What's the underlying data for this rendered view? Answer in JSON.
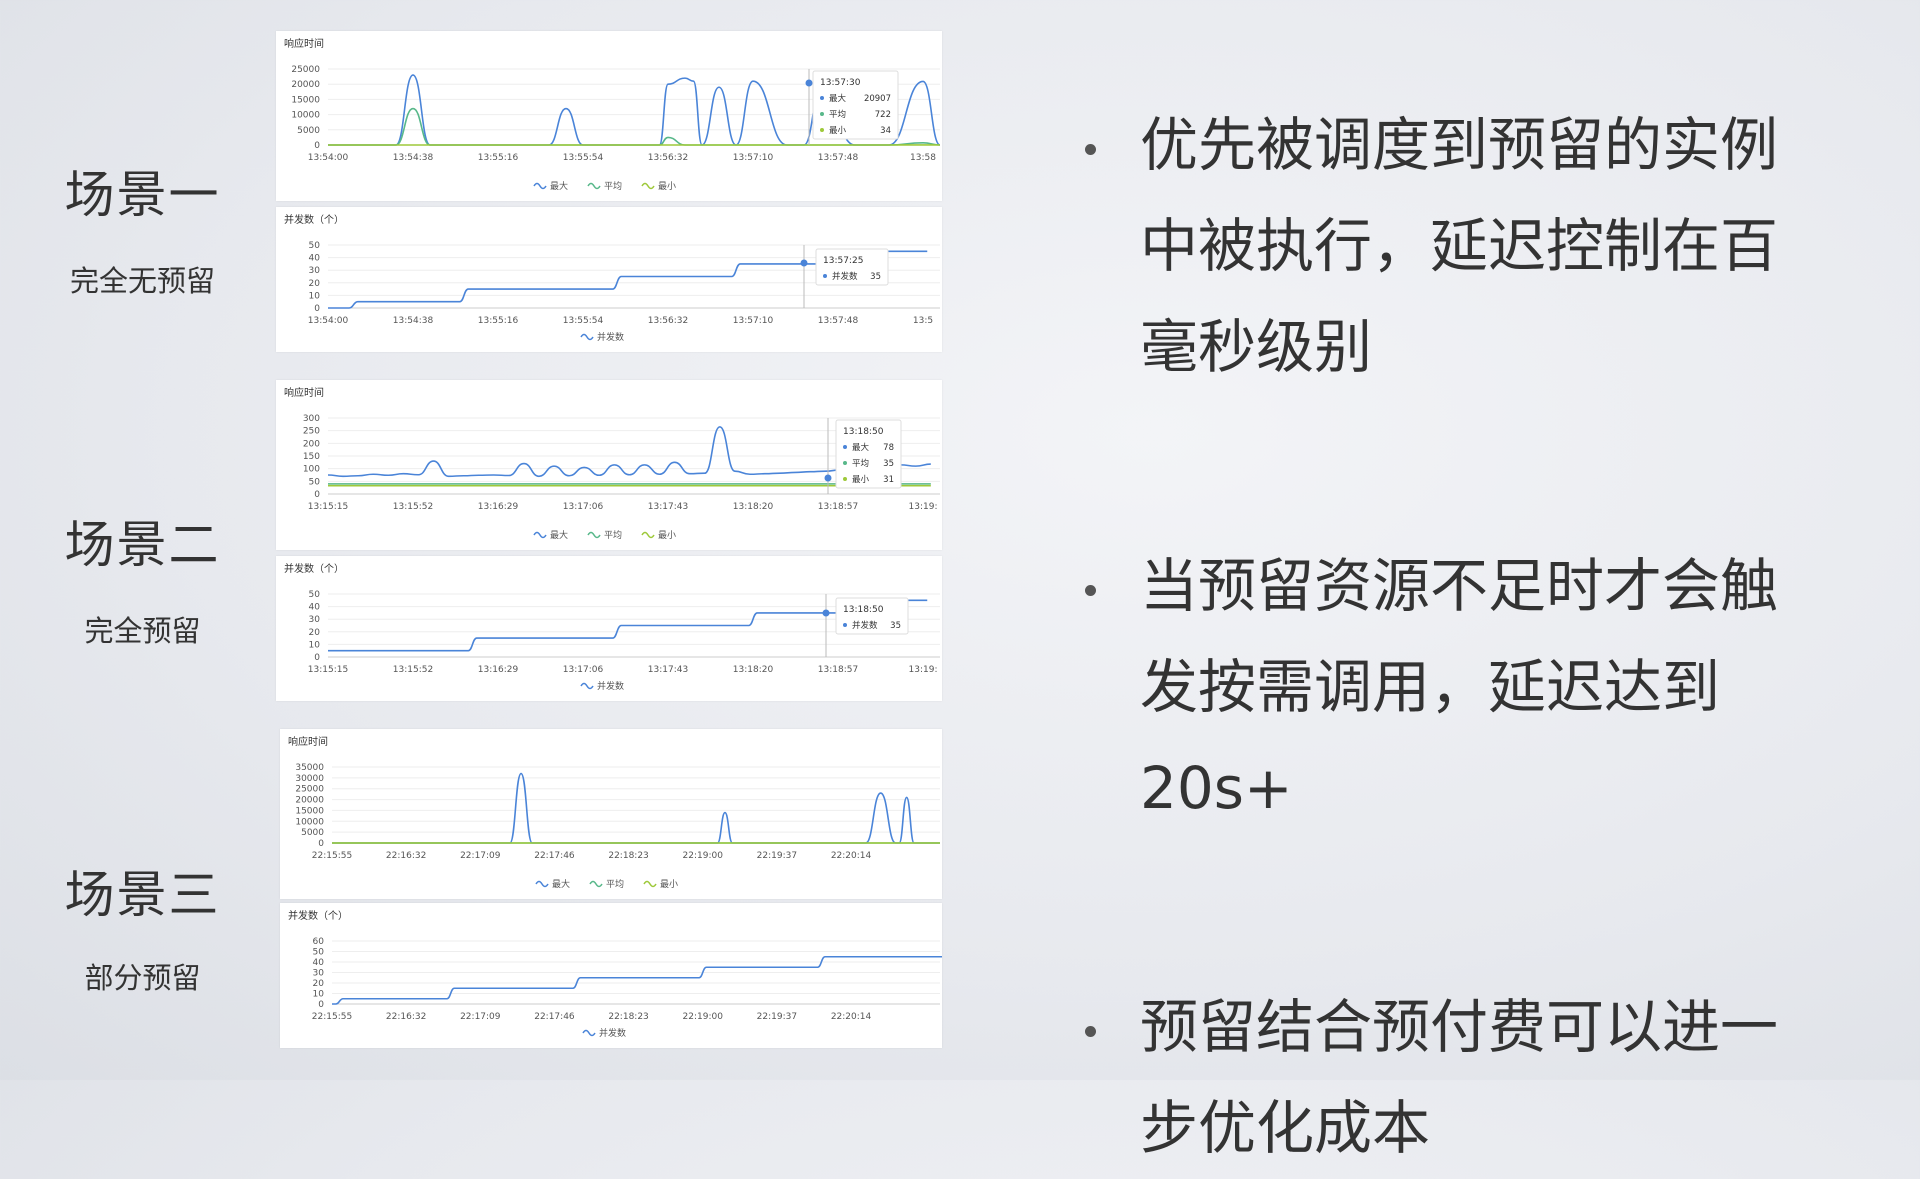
{
  "colors": {
    "max": "#4a84d8",
    "avg": "#58b88a",
    "min": "#9ec93a",
    "grid": "#eeeeee",
    "axis": "#999999"
  },
  "scenes": [
    {
      "title": "场景一",
      "subtitle": "完全无预留"
    },
    {
      "title": "场景二",
      "subtitle": "完全预留"
    },
    {
      "title": "场景三",
      "subtitle": "部分预留"
    }
  ],
  "bullets": [
    "优先被调度到预留的实例中被执行，延迟控制在百毫秒级别",
    "当预留资源不足时才会触发按需调用，延迟达到20s+",
    "预留结合预付费可以进一步优化成本"
  ],
  "chart_data": [
    {
      "type": "line",
      "title": "响应时间",
      "yticks": [
        0,
        5000,
        10000,
        15000,
        20000,
        25000
      ],
      "ylim": [
        0,
        25000
      ],
      "categories": [
        "13:54:00",
        "13:54:38",
        "13:55:16",
        "13:55:54",
        "13:56:32",
        "13:57:10",
        "13:57:48",
        "13:58"
      ],
      "x": [
        0,
        0.5,
        0.8,
        1.0,
        1.2,
        1.6,
        1.8,
        2.0,
        2.2,
        2.6,
        2.8,
        3.0,
        3.2,
        3.7,
        3.9,
        4.0,
        4.2,
        4.3,
        4.4,
        4.6,
        4.8,
        5.0,
        5.4,
        5.6,
        5.8,
        6.2,
        6.4,
        6.6,
        7.0,
        7.2
      ],
      "series": [
        {
          "name": "最大",
          "values": [
            0,
            0,
            0,
            23000,
            0,
            0,
            0,
            0,
            0,
            0,
            12000,
            0,
            0,
            0,
            0,
            20000,
            22000,
            21000,
            0,
            19000,
            0,
            21000,
            0,
            0,
            18000,
            0,
            0,
            0,
            20907,
            0
          ]
        },
        {
          "name": "平均",
          "values": [
            0,
            0,
            0,
            12000,
            0,
            0,
            0,
            0,
            0,
            0,
            0,
            0,
            0,
            0,
            0,
            2500,
            0,
            0,
            0,
            0,
            0,
            0,
            0,
            0,
            0,
            0,
            0,
            0,
            722,
            0
          ]
        },
        {
          "name": "最小",
          "values": [
            0,
            0,
            0,
            0,
            0,
            0,
            0,
            0,
            0,
            0,
            0,
            0,
            0,
            0,
            0,
            0,
            0,
            0,
            0,
            0,
            0,
            0,
            0,
            0,
            0,
            0,
            0,
            0,
            34,
            0
          ]
        }
      ],
      "tooltip": {
        "time": "13:57:30",
        "rows": [
          {
            "label": "最大",
            "value": "20907"
          },
          {
            "label": "平均",
            "value": "722"
          },
          {
            "label": "最小",
            "value": "34"
          }
        ]
      }
    },
    {
      "type": "line",
      "title": "并发数（个）",
      "yticks": [
        0,
        10,
        20,
        30,
        40,
        50
      ],
      "ylim": [
        0,
        50
      ],
      "categories": [
        "13:54:00",
        "13:54:38",
        "13:55:16",
        "13:55:54",
        "13:56:32",
        "13:57:10",
        "13:57:48",
        "13:5"
      ],
      "series": [
        {
          "name": "并发数",
          "steps": [
            [
              0,
              0
            ],
            [
              0.3,
              5
            ],
            [
              1.6,
              15
            ],
            [
              3.4,
              25
            ],
            [
              4.8,
              35
            ],
            [
              6.0,
              45
            ],
            [
              7.0,
              45
            ]
          ]
        }
      ],
      "tooltip": {
        "time": "13:57:25",
        "rows": [
          {
            "label": "并发数",
            "value": "35"
          }
        ]
      }
    },
    {
      "type": "line",
      "title": "响应时间",
      "yticks": [
        0,
        50,
        100,
        150,
        200,
        250,
        300
      ],
      "ylim": [
        0,
        300
      ],
      "categories": [
        "13:15:15",
        "13:15:52",
        "13:16:29",
        "13:17:06",
        "13:17:43",
        "13:18:20",
        "13:18:57",
        "13:19:"
      ],
      "series": [
        {
          "name": "最大",
          "values": [
            75,
            70,
            72,
            78,
            74,
            80,
            76,
            130,
            70,
            72,
            74,
            75,
            73,
            120,
            70,
            110,
            72,
            105,
            74,
            115,
            76,
            115,
            78,
            125,
            80,
            82,
            265,
            90,
            78,
            80,
            82,
            85,
            88,
            90,
            95,
            78,
            110,
            112,
            115,
            110,
            118
          ]
        },
        {
          "name": "平均",
          "values": [
            40,
            40,
            40,
            40,
            40,
            40,
            40,
            40,
            40,
            40,
            40,
            40,
            40,
            40,
            40,
            40,
            40,
            40,
            40,
            40,
            40,
            40,
            40,
            40,
            40,
            40,
            40,
            40,
            40,
            40,
            40,
            40,
            40,
            40,
            40,
            35,
            40,
            40,
            40,
            40,
            40
          ]
        },
        {
          "name": "最小",
          "values": [
            33,
            33,
            33,
            33,
            33,
            33,
            33,
            33,
            33,
            33,
            33,
            33,
            33,
            33,
            33,
            33,
            33,
            33,
            33,
            33,
            33,
            33,
            33,
            33,
            33,
            33,
            33,
            33,
            33,
            33,
            33,
            33,
            33,
            33,
            33,
            31,
            33,
            33,
            33,
            33,
            33
          ]
        }
      ],
      "tooltip": {
        "time": "13:18:50",
        "rows": [
          {
            "label": "最大",
            "value": "78"
          },
          {
            "label": "平均",
            "value": "35"
          },
          {
            "label": "最小",
            "value": "31"
          }
        ]
      }
    },
    {
      "type": "line",
      "title": "并发数（个）",
      "yticks": [
        0,
        10,
        20,
        30,
        40,
        50
      ],
      "ylim": [
        0,
        50
      ],
      "categories": [
        "13:15:15",
        "13:15:52",
        "13:16:29",
        "13:17:06",
        "13:17:43",
        "13:18:20",
        "13:18:57",
        "13:19:"
      ],
      "series": [
        {
          "name": "并发数",
          "steps": [
            [
              0,
              5
            ],
            [
              1.7,
              15
            ],
            [
              3.4,
              25
            ],
            [
              5.0,
              35
            ],
            [
              6.6,
              45
            ],
            [
              7.0,
              45
            ]
          ]
        }
      ],
      "tooltip": {
        "time": "13:18:50",
        "rows": [
          {
            "label": "并发数",
            "value": "35"
          }
        ]
      }
    },
    {
      "type": "line",
      "title": "响应时间",
      "yticks": [
        0,
        5000,
        10000,
        15000,
        20000,
        25000,
        30000,
        35000
      ],
      "ylim": [
        0,
        35000
      ],
      "categories": [
        "22:15:55",
        "22:16:32",
        "22:17:09",
        "22:17:46",
        "22:18:23",
        "22:19:00",
        "22:19:37",
        "22:20:14"
      ],
      "series": [
        {
          "name": "最大",
          "values": [
            [
              0,
              0
            ],
            [
              2.4,
              0
            ],
            [
              2.55,
              32000
            ],
            [
              2.7,
              0
            ],
            [
              5.2,
              0
            ],
            [
              5.3,
              14000
            ],
            [
              5.4,
              0
            ],
            [
              7.2,
              0
            ],
            [
              7.4,
              23000
            ],
            [
              7.6,
              0
            ],
            [
              7.65,
              0
            ],
            [
              7.75,
              21000
            ],
            [
              7.85,
              0
            ],
            [
              8.2,
              0
            ]
          ]
        },
        {
          "name": "平均",
          "values": [
            [
              0,
              0
            ],
            [
              8.2,
              0
            ]
          ]
        },
        {
          "name": "最小",
          "values": [
            [
              0,
              0
            ],
            [
              8.2,
              0
            ]
          ]
        }
      ]
    },
    {
      "type": "line",
      "title": "并发数（个）",
      "yticks": [
        0,
        10,
        20,
        30,
        40,
        50,
        60
      ],
      "ylim": [
        0,
        60
      ],
      "categories": [
        "22:15:55",
        "22:16:32",
        "22:17:09",
        "22:17:46",
        "22:18:23",
        "22:19:00",
        "22:19:37",
        "22:20:14"
      ],
      "series": [
        {
          "name": "并发数",
          "steps": [
            [
              0,
              0
            ],
            [
              0.1,
              5
            ],
            [
              1.6,
              15
            ],
            [
              3.3,
              25
            ],
            [
              5.0,
              35
            ],
            [
              6.6,
              45
            ],
            [
              8.2,
              45
            ]
          ]
        }
      ]
    }
  ]
}
